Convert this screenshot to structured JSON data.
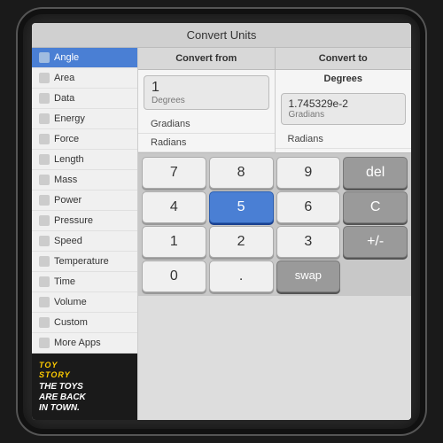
{
  "app": {
    "title": "Convert Units"
  },
  "sidebar": {
    "items": [
      {
        "id": "angle",
        "label": "Angle",
        "active": true
      },
      {
        "id": "area",
        "label": "Area",
        "active": false
      },
      {
        "id": "data",
        "label": "Data",
        "active": false
      },
      {
        "id": "energy",
        "label": "Energy",
        "active": false
      },
      {
        "id": "force",
        "label": "Force",
        "active": false
      },
      {
        "id": "length",
        "label": "Length",
        "active": false
      },
      {
        "id": "mass",
        "label": "Mass",
        "active": false
      },
      {
        "id": "power",
        "label": "Power",
        "active": false
      },
      {
        "id": "pressure",
        "label": "Pressure",
        "active": false
      },
      {
        "id": "speed",
        "label": "Speed",
        "active": false
      },
      {
        "id": "temperature",
        "label": "Temperature",
        "active": false
      },
      {
        "id": "time",
        "label": "Time",
        "active": false
      },
      {
        "id": "volume",
        "label": "Volume",
        "active": false
      },
      {
        "id": "custom",
        "label": "Custom",
        "active": false
      },
      {
        "id": "more-apps",
        "label": "More Apps",
        "active": false
      }
    ],
    "ad": {
      "line1": "THE TOYS",
      "line2": "ARE BACK",
      "line3": "IN TOWN.",
      "badge": "TOY STORY"
    }
  },
  "converter": {
    "from_header": "Convert from",
    "to_header": "Convert to",
    "input_value": "1",
    "input_unit": "Degrees",
    "from_units": [
      "Gradians",
      "Radians"
    ],
    "output_value": "1.745329e-2",
    "output_unit": "Gradians",
    "to_units": [
      "Radians"
    ]
  },
  "keypad": {
    "keys": [
      {
        "label": "7",
        "type": "number"
      },
      {
        "label": "8",
        "type": "number"
      },
      {
        "label": "9",
        "type": "number"
      },
      {
        "label": "del",
        "type": "dark"
      },
      {
        "label": "4",
        "type": "number"
      },
      {
        "label": "5",
        "type": "blue"
      },
      {
        "label": "6",
        "type": "number"
      },
      {
        "label": "C",
        "type": "dark"
      },
      {
        "label": "1",
        "type": "number"
      },
      {
        "label": "2",
        "type": "number"
      },
      {
        "label": "3",
        "type": "number"
      },
      {
        "label": "+/-",
        "type": "dark"
      },
      {
        "label": "0",
        "type": "number"
      },
      {
        "label": ".",
        "type": "number"
      },
      {
        "label": "swap",
        "type": "dark-wide"
      }
    ]
  }
}
